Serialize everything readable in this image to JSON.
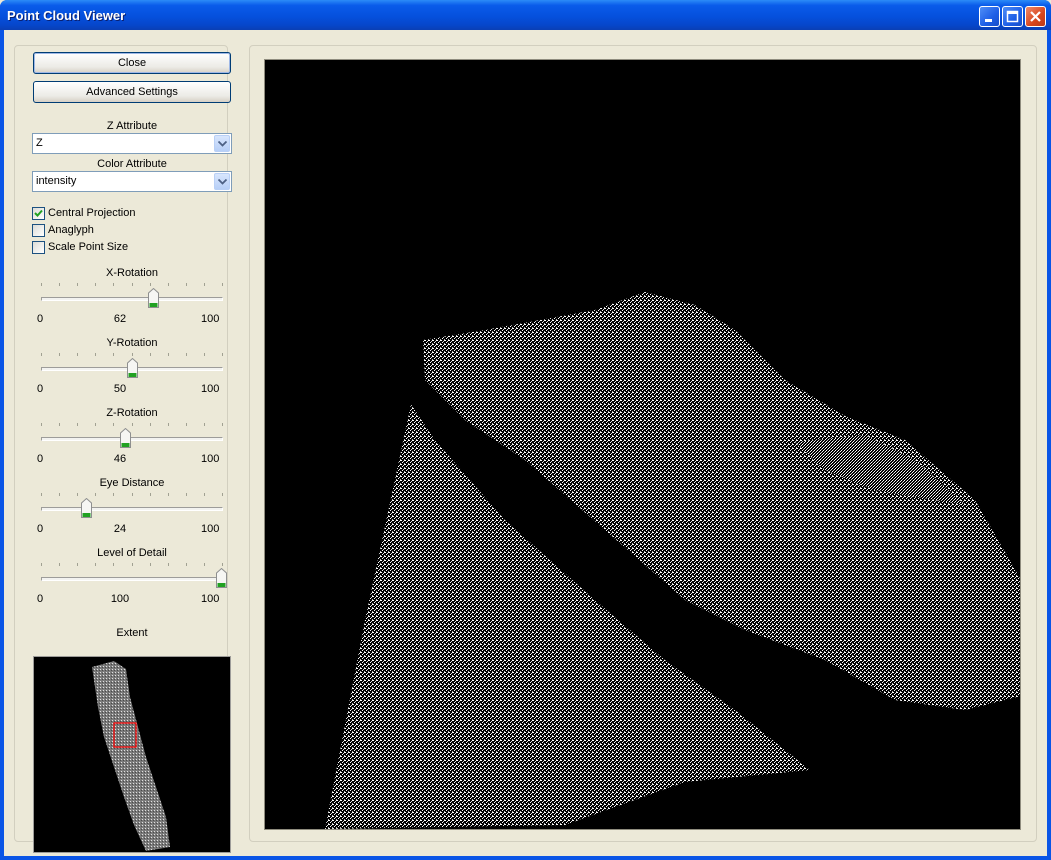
{
  "window": {
    "title": "Point Cloud Viewer"
  },
  "controls": {
    "close_label": "Close",
    "advanced_label": "Advanced Settings",
    "z_attribute": {
      "label": "Z Attribute",
      "value": "Z"
    },
    "color_attribute": {
      "label": "Color Attribute",
      "value": "intensity"
    },
    "checkboxes": [
      {
        "label": "Central Projection",
        "checked": true
      },
      {
        "label": "Anaglyph",
        "checked": false
      },
      {
        "label": "Scale Point Size",
        "checked": false
      }
    ],
    "sliders": [
      {
        "label": "X-Rotation",
        "min": "0",
        "max": "100",
        "value": "62"
      },
      {
        "label": "Y-Rotation",
        "min": "0",
        "max": "100",
        "value": "50"
      },
      {
        "label": "Z-Rotation",
        "min": "0",
        "max": "100",
        "value": "46"
      },
      {
        "label": "Eye Distance",
        "min": "0",
        "max": "100",
        "value": "24"
      },
      {
        "label": "Level of Detail",
        "min": "0",
        "max": "100",
        "value": "100"
      }
    ],
    "extent_label": "Extent"
  },
  "colors": {
    "accent": "#0a55e6",
    "background": "#ece9d8",
    "selection": "#ff0000",
    "thumb_green": "#21a121"
  }
}
